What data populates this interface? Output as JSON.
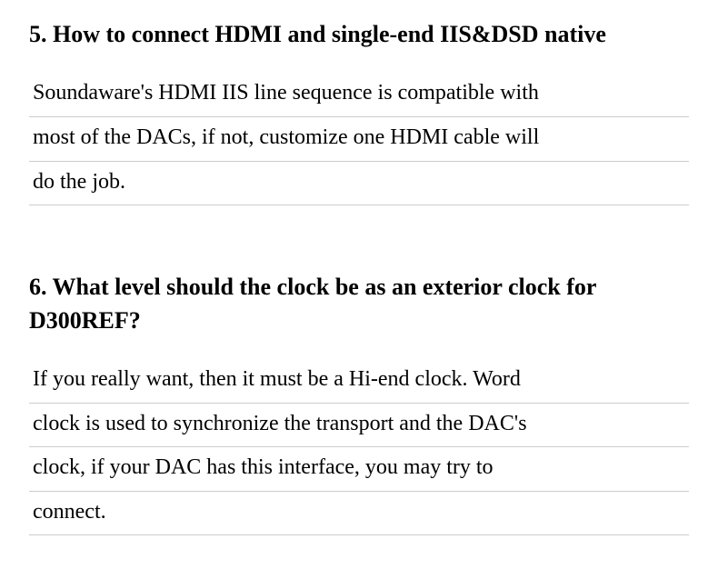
{
  "section5": {
    "heading": "5. How to connect HDMI and single-end IIS&DSD native",
    "lines": [
      "Soundaware's HDMI IIS line sequence is compatible with",
      "most of the DACs, if not, customize one HDMI cable will",
      "do the job."
    ]
  },
  "section6": {
    "heading": "6. What level should the clock be as an exterior clock for D300REF?",
    "lines": [
      "If you really want, then it must be a Hi-end clock. Word",
      "clock is used to synchronize the transport and the DAC's",
      "clock, if your DAC has this interface, you may try to",
      "connect."
    ]
  }
}
